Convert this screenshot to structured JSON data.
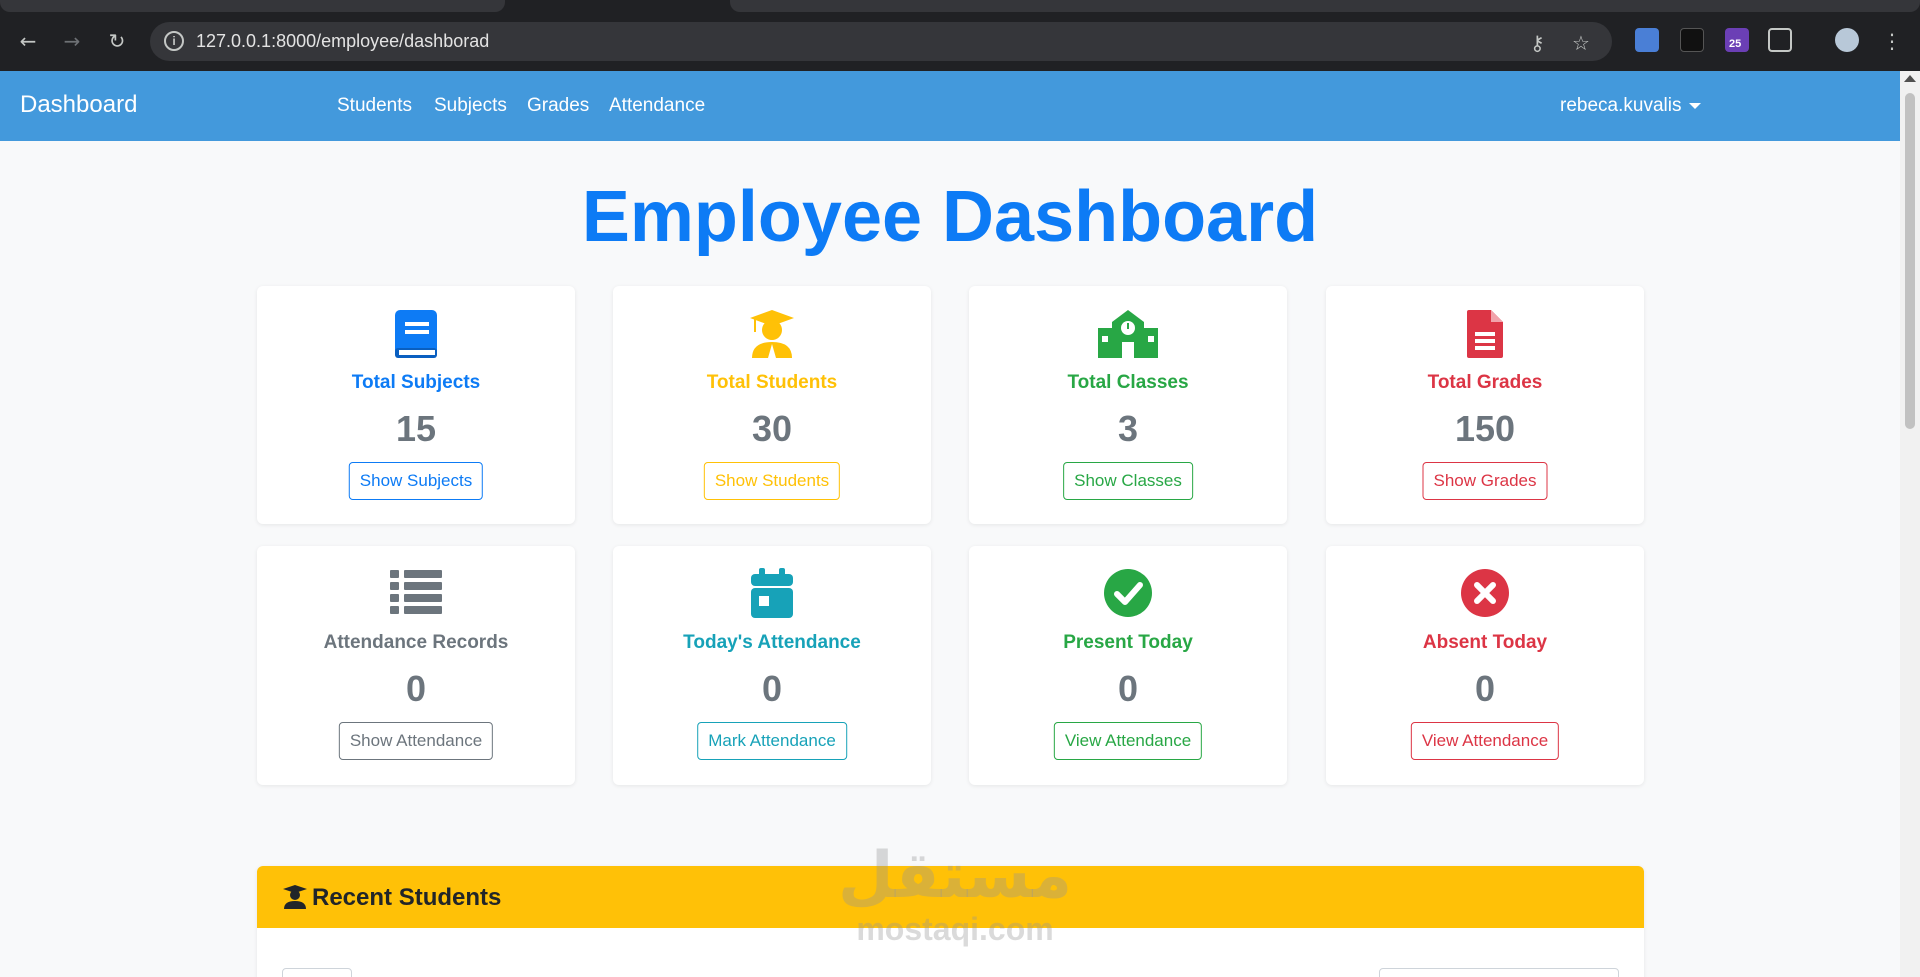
{
  "browser": {
    "url": "127.0.0.1:8000/employee/dashborad",
    "extension_badge": "25"
  },
  "navbar": {
    "brand": "Dashboard",
    "links": [
      "Students",
      "Subjects",
      "Grades",
      "Attendance"
    ],
    "user": "rebeca.kuvalis"
  },
  "page": {
    "title": "Employee Dashboard"
  },
  "cards": [
    {
      "label": "Total Subjects",
      "value": "15",
      "button": "Show Subjects",
      "color": "#0d7bf5",
      "icon": "book-icon"
    },
    {
      "label": "Total Students",
      "value": "30",
      "button": "Show Students",
      "color": "#ffc107",
      "icon": "graduate-icon"
    },
    {
      "label": "Total Classes",
      "value": "3",
      "button": "Show Classes",
      "color": "#28a745",
      "icon": "school-icon"
    },
    {
      "label": "Total Grades",
      "value": "150",
      "button": "Show Grades",
      "color": "#dc3545",
      "icon": "file-icon"
    },
    {
      "label": "Attendance Records",
      "value": "0",
      "button": "Show Attendance",
      "color": "#6c757d",
      "icon": "list-icon"
    },
    {
      "label": "Today's Attendance",
      "value": "0",
      "button": "Mark Attendance",
      "color": "#17a2b8",
      "icon": "calendar-icon"
    },
    {
      "label": "Present Today",
      "value": "0",
      "button": "View Attendance",
      "color": "#28a745",
      "icon": "check-circle-icon"
    },
    {
      "label": "Absent Today",
      "value": "0",
      "button": "View Attendance",
      "color": "#dc3545",
      "icon": "times-circle-icon"
    }
  ],
  "recent_students": {
    "title": "Recent Students"
  },
  "watermark": {
    "arabic": "مستقل",
    "latin": "mostaqi.com"
  }
}
